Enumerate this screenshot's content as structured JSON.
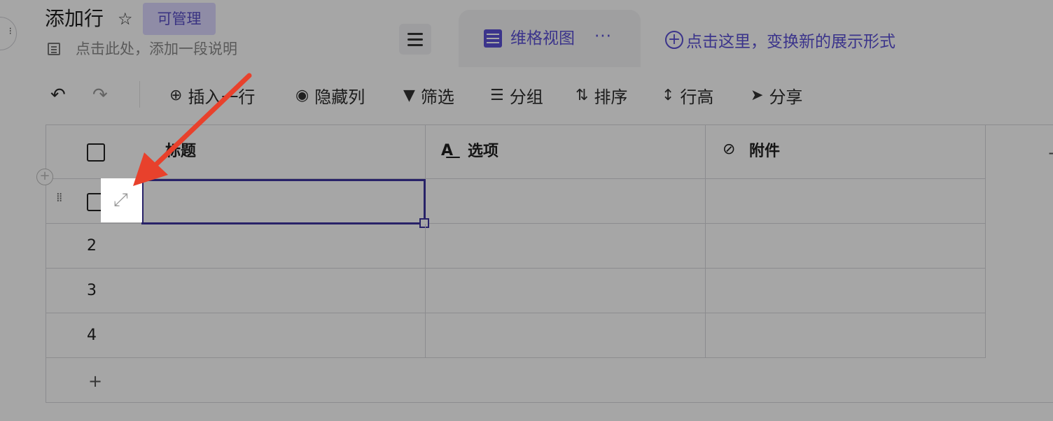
{
  "header": {
    "title": "添加行",
    "permission_badge": "可管理",
    "description_placeholder": "点击此处，添加一段说明",
    "view_tab_label": "维格视图",
    "view_more": "···",
    "add_view_label": "点击这里，变换新的展示形式"
  },
  "toolbar": {
    "insert_row": "插入一行",
    "hide_columns": "隐藏列",
    "filter": "筛选",
    "group": "分组",
    "sort": "排序",
    "row_height": "行高",
    "share": "分享"
  },
  "table": {
    "columns": [
      "标题",
      "选项",
      "附件"
    ],
    "row_numbers": [
      "2",
      "3",
      "4"
    ],
    "add_row_symbol": "+",
    "add_column_symbol": "+"
  },
  "icons": {
    "star": "star-icon",
    "expand": "expand-icon",
    "filter": "filter-icon",
    "share": "paper-plane-icon"
  },
  "colors": {
    "accent": "#5b50d6",
    "selection": "#3e35a0",
    "annotation_arrow": "#e8412c"
  }
}
